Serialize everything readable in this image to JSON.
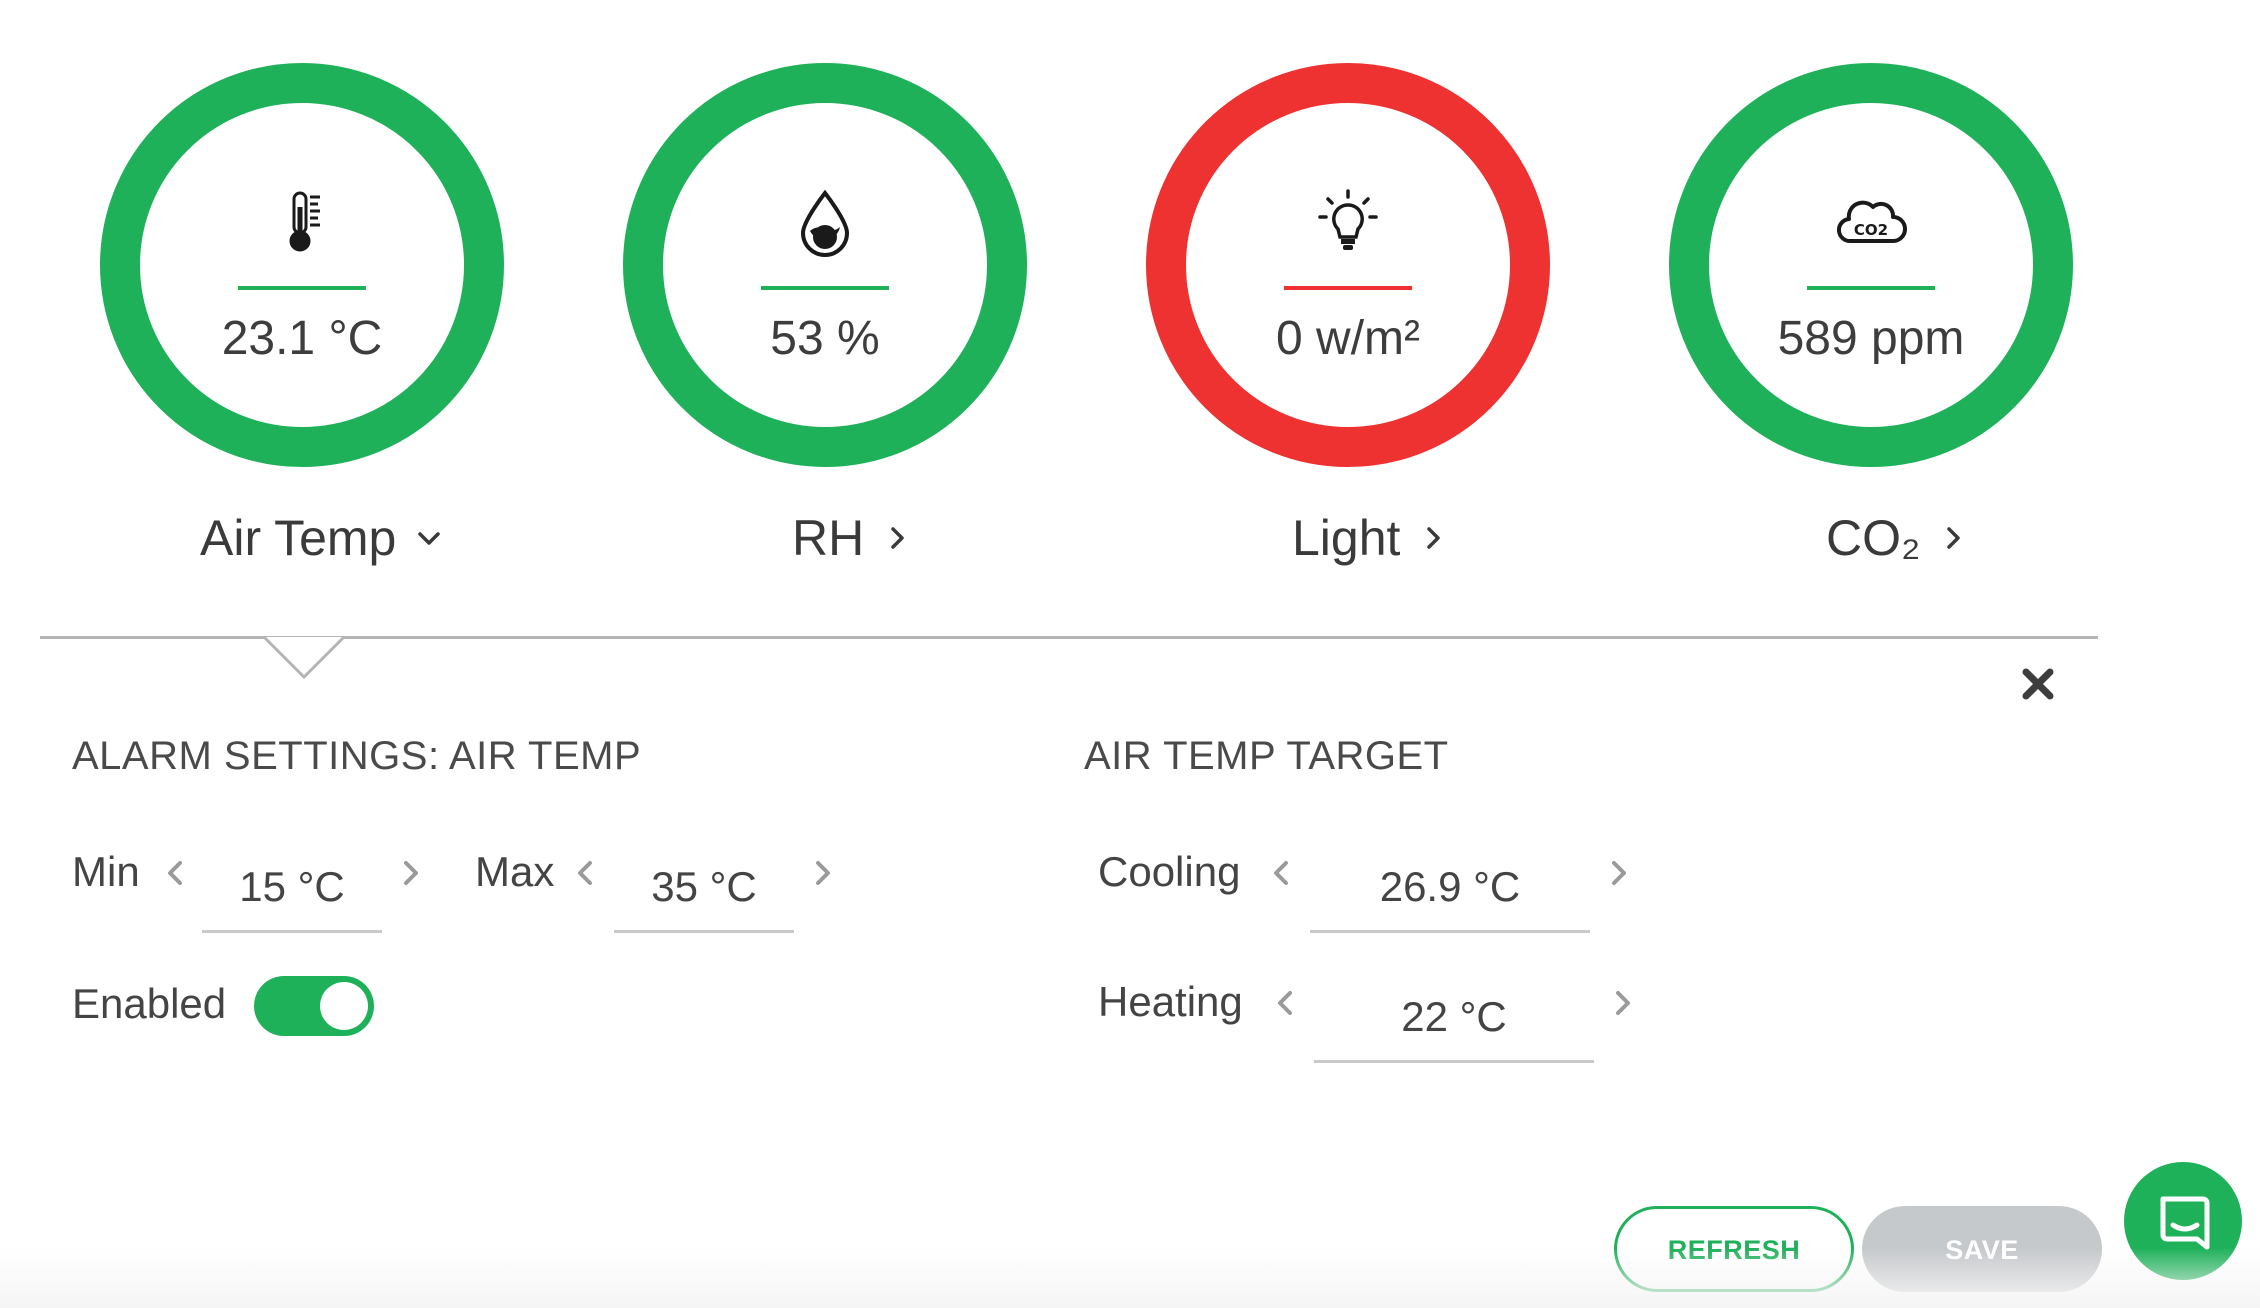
{
  "metrics": [
    {
      "id": "air-temp",
      "value": "23.1 °C",
      "label": "Air Temp",
      "icon": "thermometer-icon",
      "chevron": "chevron-down-icon",
      "status": "ok",
      "status_color": "#1fb15a"
    },
    {
      "id": "rh",
      "value": "53 %",
      "label": "RH",
      "icon": "water-drop-icon",
      "chevron": "chevron-right-icon",
      "status": "ok",
      "status_color": "#1fb15a"
    },
    {
      "id": "light",
      "value": "0 w/m²",
      "label": "Light",
      "icon": "light-bulb-icon",
      "chevron": "chevron-right-icon",
      "status": "alert",
      "status_color": "#ee3232"
    },
    {
      "id": "co2",
      "value": "589 ppm",
      "label": "CO₂",
      "icon": "co2-cloud-icon",
      "chevron": "chevron-right-icon",
      "status": "ok",
      "status_color": "#1fb15a"
    }
  ],
  "alarm": {
    "title": "ALARM SETTINGS: AIR TEMP",
    "min_label": "Min",
    "min_value": "15 °C",
    "max_label": "Max",
    "max_value": "35 °C",
    "enabled_label": "Enabled",
    "enabled": true
  },
  "target": {
    "title": "AIR TEMP TARGET",
    "cooling_label": "Cooling",
    "cooling_value": "26.9 °C",
    "heating_label": "Heating",
    "heating_value": "22 °C"
  },
  "actions": {
    "refresh_label": "REFRESH",
    "save_label": "SAVE"
  },
  "colors": {
    "ok": "#1fb15a",
    "alert": "#ee3232",
    "disabled": "#c6c9cc"
  }
}
